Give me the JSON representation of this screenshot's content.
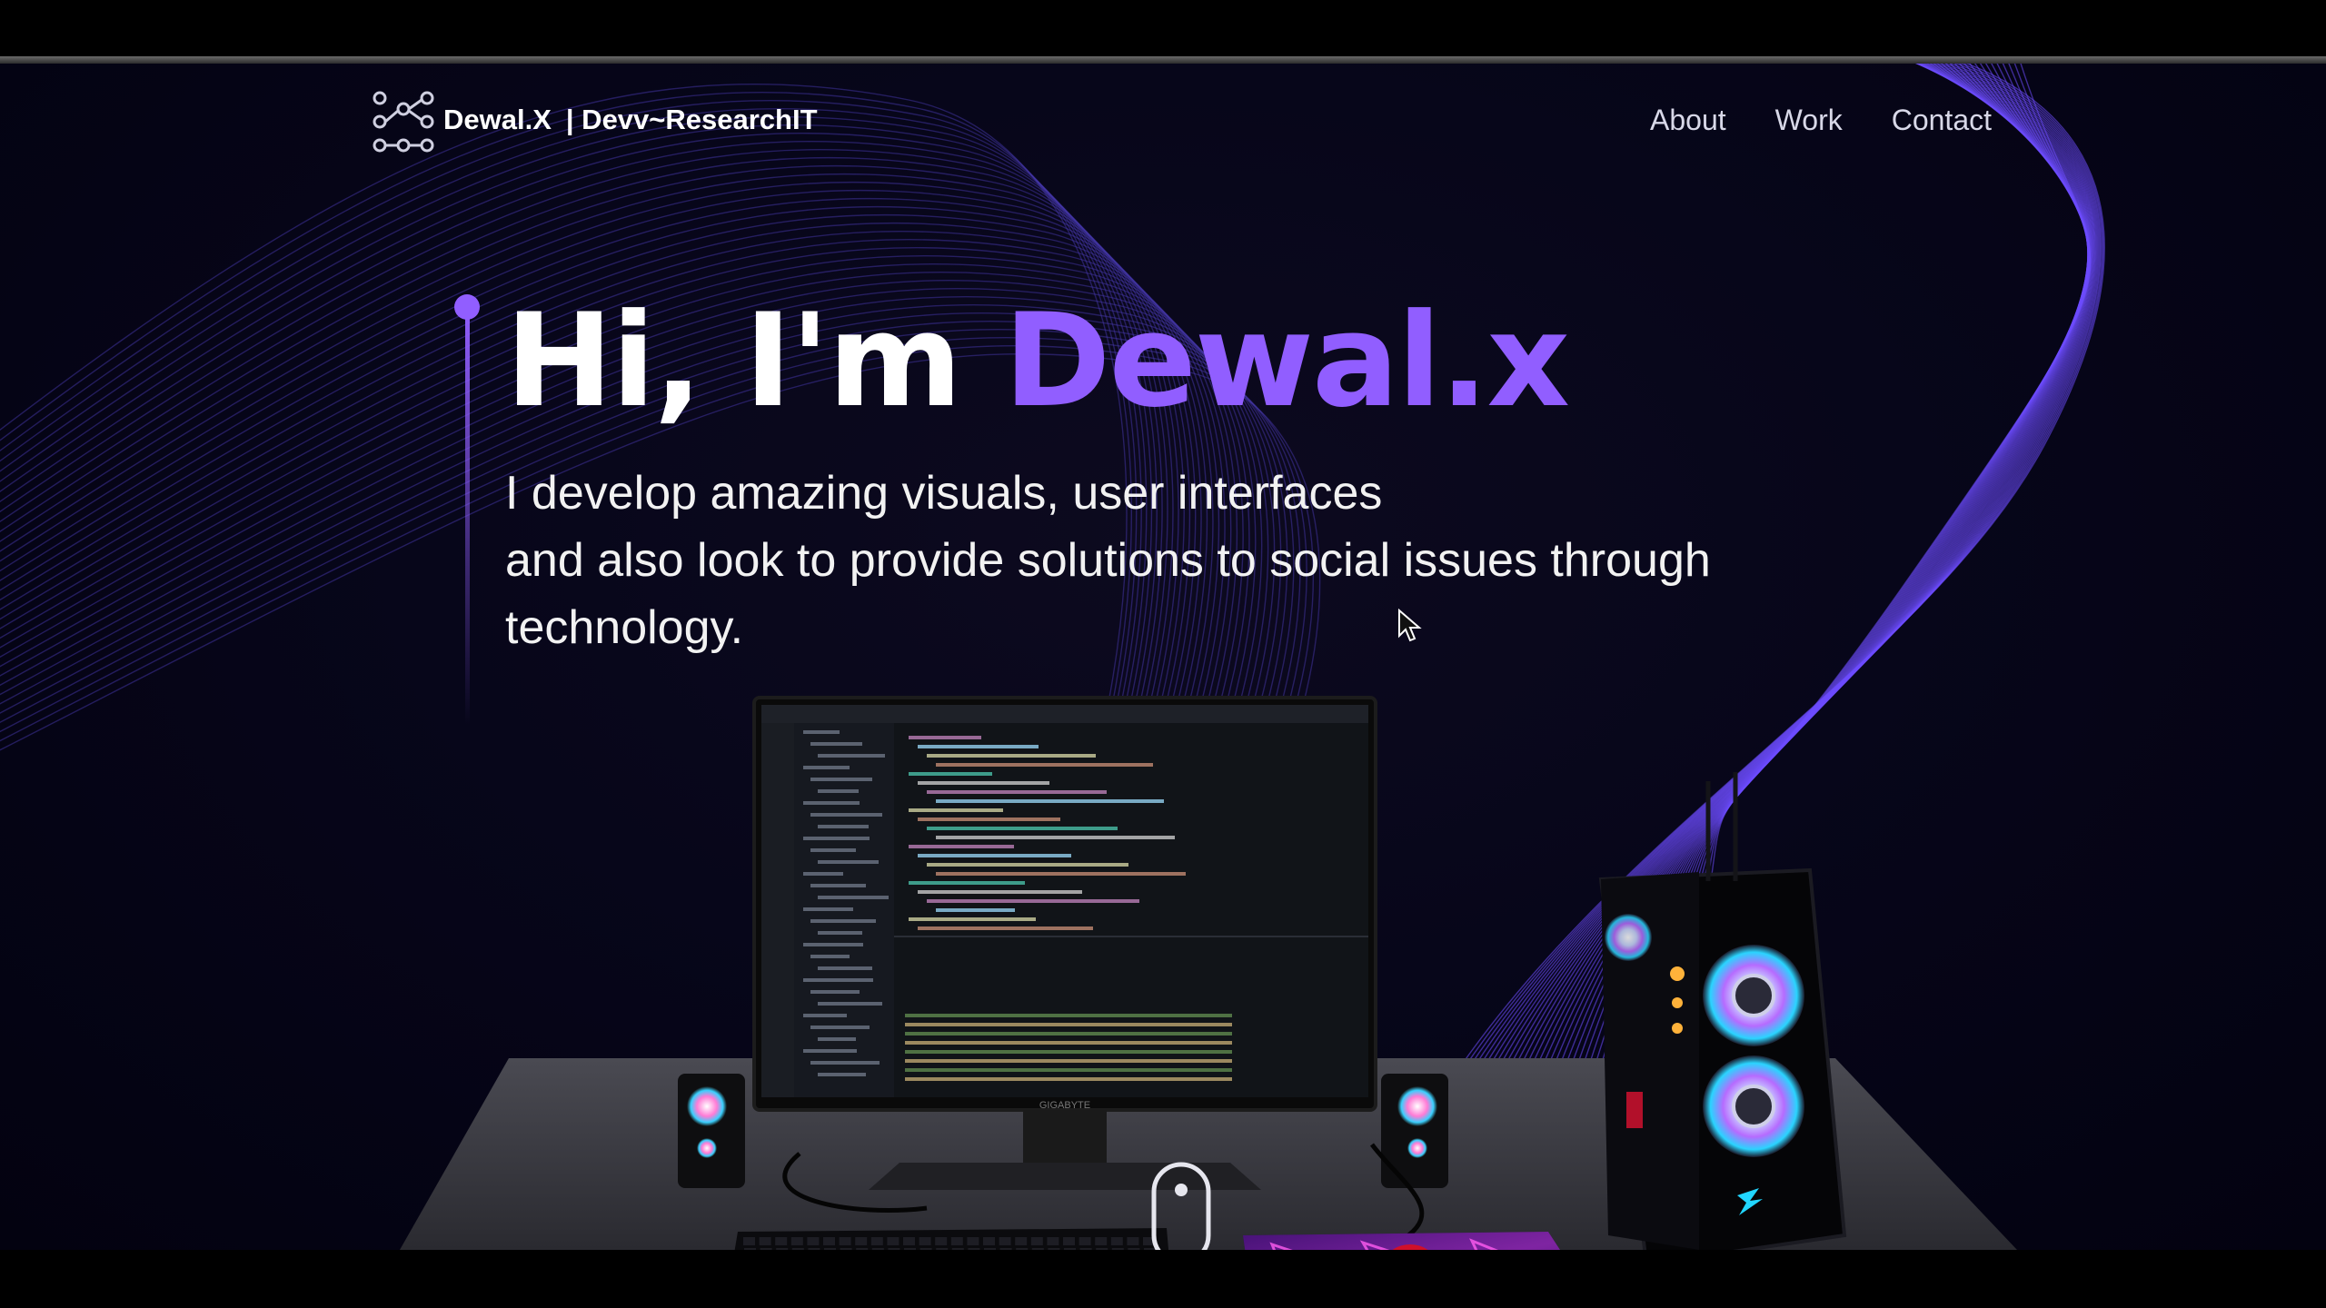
{
  "nav": {
    "brand_name": "Dewal.X",
    "brand_tagline": "| Devv~ResearchIT",
    "links": [
      {
        "label": "About"
      },
      {
        "label": "Work"
      },
      {
        "label": "Contact"
      }
    ]
  },
  "hero": {
    "greeting": "Hi, I'm ",
    "name": "Dewal.x",
    "subtitle_line1": "I develop amazing visuals, user interfaces",
    "subtitle_line2": "and also look to provide solutions to social issues through technology."
  },
  "monitor": {
    "brand_label": "GIGABYTE"
  },
  "colors": {
    "accent": "#915eff",
    "background": "#050314",
    "text": "#ffffff"
  },
  "icons": {
    "logo": "network-graph-icon",
    "cursor": "mouse-pointer-icon"
  }
}
